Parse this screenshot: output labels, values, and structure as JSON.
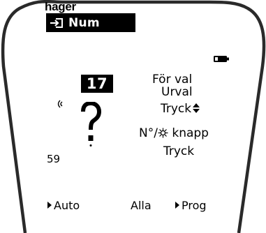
{
  "brand": {
    "name": "hager"
  },
  "header": {
    "icon": "enter-arrow-icon",
    "title": "Num"
  },
  "status": {
    "battery_icon": "battery-icon"
  },
  "display": {
    "number_badge": "17",
    "signal_icon": "signal-wave-icon",
    "status_symbol": "?",
    "value_59": "59"
  },
  "instructions": {
    "line1": "För val",
    "line2": "Urval",
    "line3": "Tryck",
    "line3_icon": "up-down-icon",
    "line4_prefix": "N°/",
    "line4_icon": "star-icon",
    "line4_suffix": " knapp",
    "line5": "Tryck"
  },
  "softkeys": {
    "left": "Auto",
    "middle": "Alla",
    "right": "Prog"
  }
}
